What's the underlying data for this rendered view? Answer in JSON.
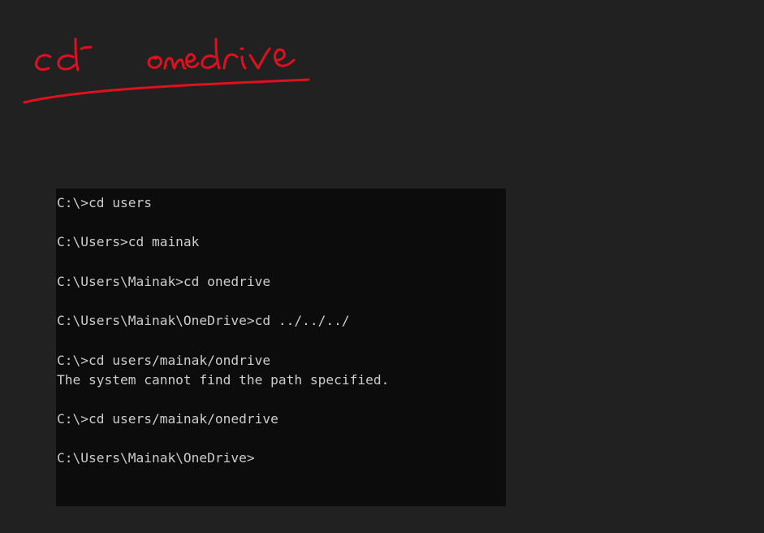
{
  "annotation": {
    "handwritten_text": "cd onedrive",
    "ink_color": "#e0101e"
  },
  "terminal": {
    "background": "#0c0c0c",
    "text_color": "#cccccc",
    "lines": [
      "C:\\>cd users",
      "",
      "C:\\Users>cd mainak",
      "",
      "C:\\Users\\Mainak>cd onedrive",
      "",
      "C:\\Users\\Mainak\\OneDrive>cd ../../../",
      "",
      "C:\\>cd users/mainak/ondrive",
      "The system cannot find the path specified.",
      "",
      "C:\\>cd users/mainak/onedrive",
      "",
      "C:\\Users\\Mainak\\OneDrive>"
    ]
  }
}
